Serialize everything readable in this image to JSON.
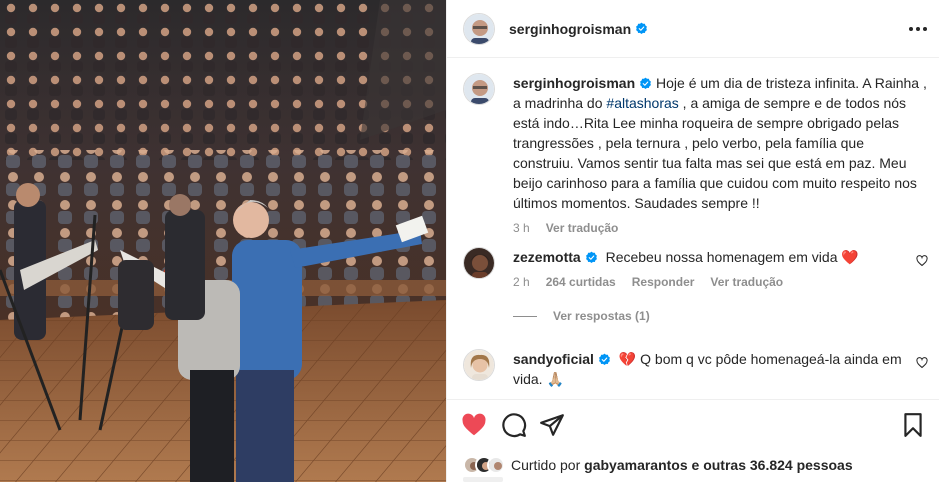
{
  "post": {
    "author": "serginhogroisman",
    "photo_alt_semantic": "stage-photo"
  },
  "caption": {
    "username": "serginhogroisman",
    "text_before_tag": "Hoje é um dia de tristeza infinita. A Rainha , a madrinha do ",
    "hashtag": "#altashoras",
    "text_after_tag": " , a amiga de sempre e de todos nós está indo…Rita Lee minha roqueira de sempre obrigado pelas trangressões , pela ternura , pelo verbo, pela família que construiu. Vamos sentir tua falta mas sei que está em paz. Meu beijo carinhoso para a família que cuidou com muito respeito nos últimos momentos. Saudades sempre !!",
    "time": "3 h",
    "translate": "Ver tradução"
  },
  "comments": [
    {
      "username": "zezemotta",
      "text": "Recebeu nossa homenagem em vida ❤️",
      "time": "2 h",
      "likes": "264 curtidas",
      "reply": "Responder",
      "translate": "Ver tradução",
      "view_replies": "Ver respostas (1)"
    },
    {
      "username": "sandyoficial",
      "text": "💔 Q bom q vc pôde homenageá-la ainda em vida. 🙏🏼"
    }
  ],
  "likes": {
    "prefix": "Curtido por",
    "user": "gabyamarantos",
    "suffix": "e outras 36.824 pessoas"
  },
  "colors": {
    "verified": "#0095f6",
    "heart_active": "#ed4956",
    "text": "#262626",
    "muted": "#8e8e8e",
    "hashtag": "#00376b"
  },
  "icons": [
    "verified-badge-icon",
    "more-options-icon",
    "heart-icon",
    "comment-icon",
    "share-icon",
    "bookmark-icon"
  ]
}
